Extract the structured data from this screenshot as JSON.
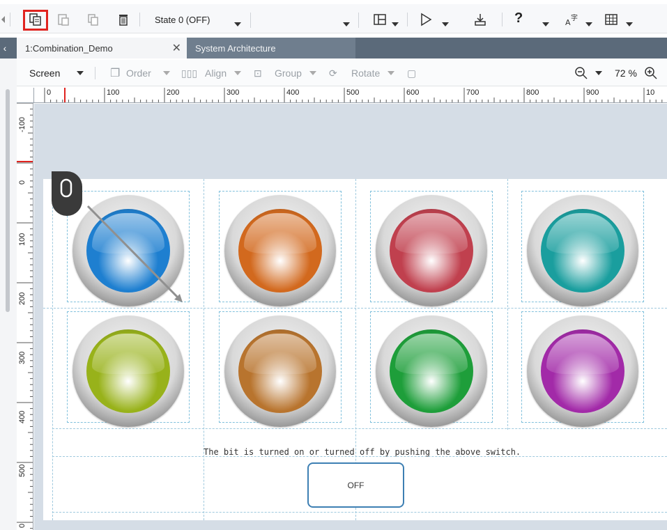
{
  "toolbar": {
    "state_value": "State 0 (OFF)",
    "help_label": "?",
    "icons": [
      "copy-icon",
      "paste-icon",
      "duplicate-icon",
      "delete-icon",
      "layout-icon",
      "play-icon",
      "download-icon",
      "help-icon",
      "font-icon",
      "table-icon"
    ]
  },
  "tabs": [
    {
      "label": "1:Combination_Demo",
      "close": "✕"
    },
    {
      "label": "System Architecture"
    }
  ],
  "editbar": {
    "screen_label": "Screen",
    "order_label": "Order",
    "align_label": "Align",
    "group_label": "Group",
    "rotate_label": "Rotate",
    "zoom_value": "72 %"
  },
  "ruler_top": [
    "0",
    "100",
    "200",
    "300",
    "400",
    "500",
    "600",
    "700",
    "800",
    "900",
    "10"
  ],
  "ruler_left": [
    "-100",
    "0",
    "100",
    "200",
    "300",
    "400",
    "500",
    "0"
  ],
  "lamps": [
    {
      "color": "blue",
      "hex": "#1e7fd0"
    },
    {
      "color": "orange",
      "hex": "#d2691e"
    },
    {
      "color": "red",
      "hex": "#c0404e"
    },
    {
      "color": "teal",
      "hex": "#1a9e9e"
    },
    {
      "color": "yellow-green",
      "hex": "#98b21a"
    },
    {
      "color": "brown",
      "hex": "#b8742e"
    },
    {
      "color": "green",
      "hex": "#1e9e3a"
    },
    {
      "color": "purple",
      "hex": "#a22aa8"
    }
  ],
  "caption": "The bit is turned on or turned off by pushing the above switch.",
  "switch_label": "OFF",
  "colors": {
    "highlight": "#e0231f",
    "tab_bar": "#5b6a7a",
    "canvas": "#d5dde6",
    "switch_border": "#3d7fb3"
  }
}
